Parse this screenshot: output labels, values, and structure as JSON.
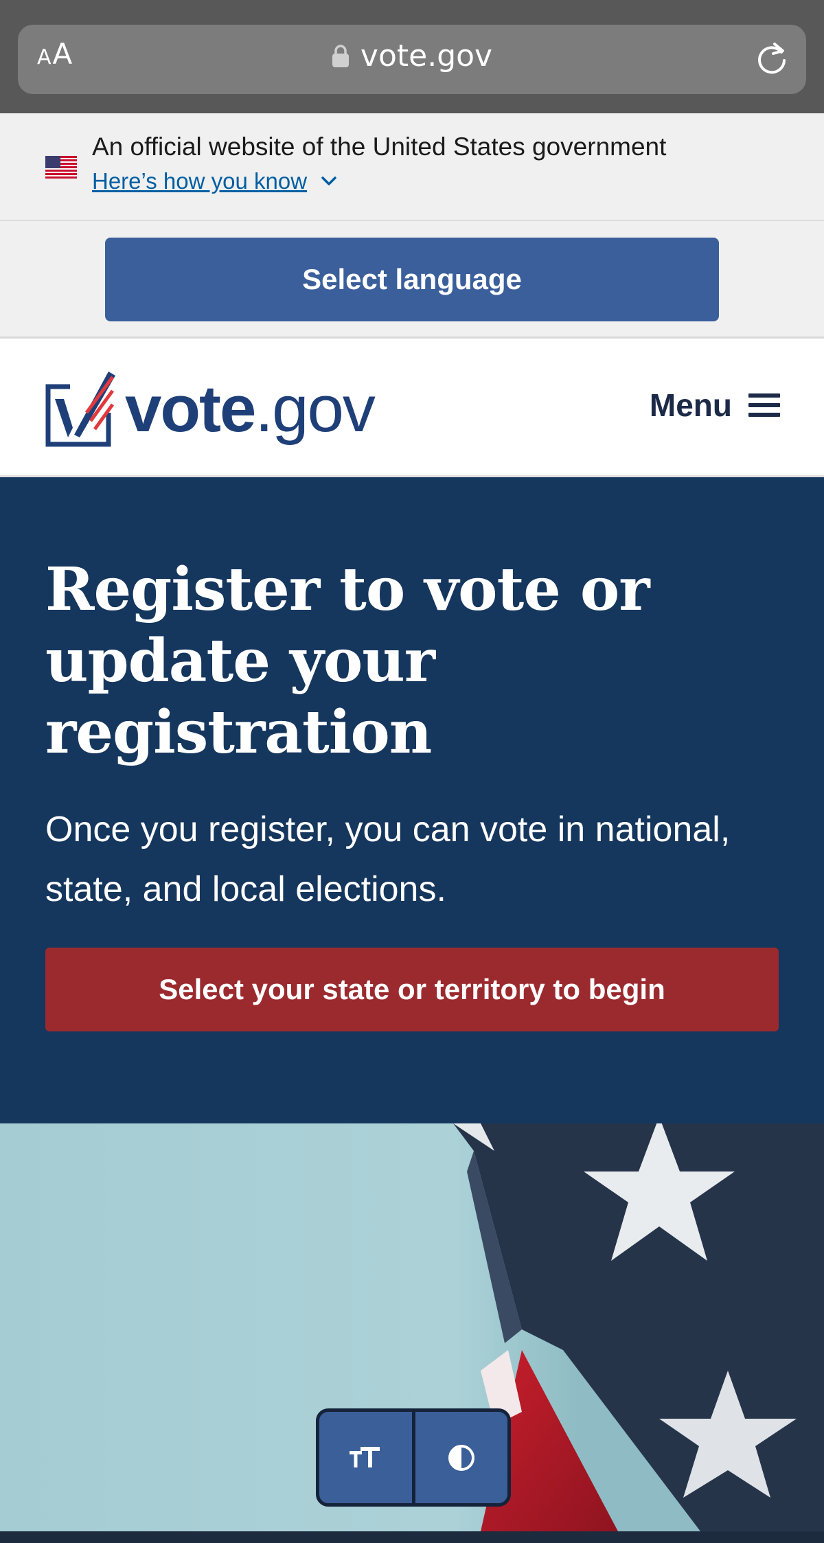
{
  "browser": {
    "text_size_small": "A",
    "text_size_big": "A",
    "url": "vote.gov",
    "reload_icon": "reload-icon",
    "lock_icon": "lock-icon"
  },
  "gov_banner": {
    "official_text": "An official website of the United States government",
    "how_you_know": "Here’s how you know",
    "flag_icon": "us-flag-icon"
  },
  "language": {
    "button_label": "Select language"
  },
  "header": {
    "logo_vote": "vote",
    "logo_dot_gov": ".gov",
    "menu_label": "Menu",
    "menu_icon": "hamburger-icon"
  },
  "hero": {
    "title": "Register to vote or update your registration",
    "subtitle": "Once you register, you can vote in national, state, and local elections.",
    "cta_label": "Select your state or territory to begin"
  },
  "accessibility_toolbar": {
    "text_size_icon": "text-size-icon",
    "contrast_icon": "contrast-icon"
  },
  "colors": {
    "hero_bg": "#15365d",
    "cta_bg": "#9b2a2f",
    "primary_button": "#3a5f9b",
    "link": "#005ea2"
  }
}
